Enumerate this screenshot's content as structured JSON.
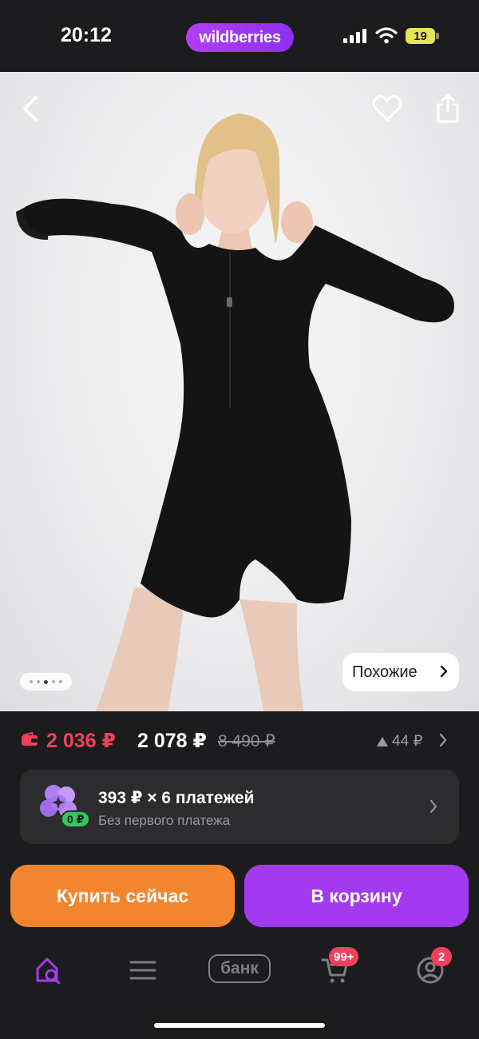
{
  "status_bar": {
    "time": "20:12",
    "brand": "wildberries",
    "battery": "19",
    "icons": [
      "signal-icon",
      "wifi-icon",
      "battery-icon"
    ]
  },
  "product": {
    "image_dots": {
      "count": 5,
      "active_index": 3
    },
    "similar_label": "Похожие",
    "icons": [
      "back-arrow-icon",
      "heart-icon",
      "share-icon"
    ]
  },
  "price": {
    "wallet_price": "2 036 ₽",
    "current_price": "2 078 ₽",
    "old_price": "8 490 ₽",
    "delta": "44 ₽"
  },
  "installment": {
    "title": "393 ₽ × 6 платежей",
    "subtitle": "Без первого платежа",
    "badge": "0 ₽"
  },
  "actions": {
    "buy_now": "Купить сейчас",
    "add_to_cart": "В корзину"
  },
  "bottom_nav": {
    "bank_label": "банк",
    "cart_badge": "99+",
    "profile_badge": "2",
    "accent_color": "#a33af0"
  }
}
